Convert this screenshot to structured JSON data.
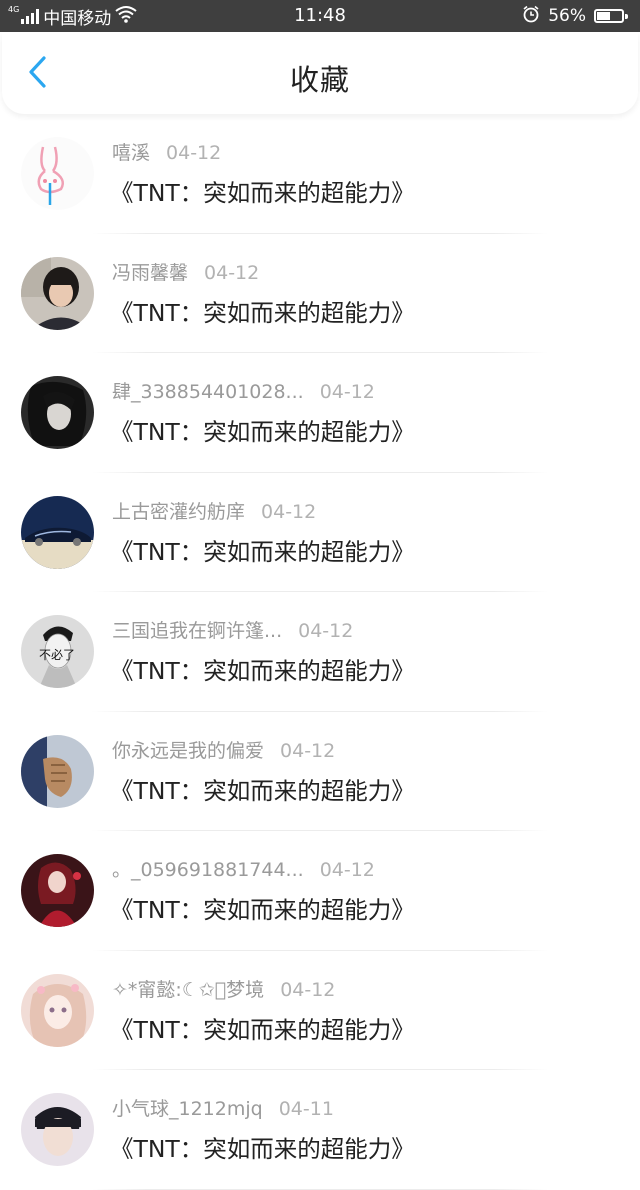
{
  "status_bar": {
    "network": "4G",
    "carrier": "中国移动",
    "time": "11:48",
    "battery": "56%",
    "battery_level": 0.56,
    "icons": [
      "signal-icon",
      "wifi-icon",
      "alarm-icon",
      "battery-icon"
    ]
  },
  "header": {
    "back_icon": "chevron-left-icon",
    "title": "收藏",
    "accent_color": "#2ba7f0"
  },
  "favorites": [
    {
      "user": "嘻溪",
      "date": "04-12",
      "content": "《TNT：突如而来的超能力》"
    },
    {
      "user": "冯雨馨馨",
      "date": "04-12",
      "content": "《TNT：突如而来的超能力》"
    },
    {
      "user": "肆_338854401028...",
      "date": "04-12",
      "content": "《TNT：突如而来的超能力》"
    },
    {
      "user": "上古密灌约舫庠",
      "date": "04-12",
      "content": "《TNT：突如而来的超能力》"
    },
    {
      "user": "三国追我在锕许篷...",
      "date": "04-12",
      "content": "《TNT：突如而来的超能力》",
      "avatar_caption": "不必了"
    },
    {
      "user": "你永远是我的偏爱",
      "date": "04-12",
      "content": "《TNT：突如而来的超能力》"
    },
    {
      "user": "。_059691881744...",
      "date": "04-12",
      "content": "《TNT：突如而来的超能力》"
    },
    {
      "user": "✧*甯懿:☾✩⃝梦境",
      "date": "04-12",
      "content": "《TNT：突如而来的超能力》"
    },
    {
      "user": "小气球_1212mjq",
      "date": "04-11",
      "content": "《TNT：突如而来的超能力》"
    }
  ]
}
